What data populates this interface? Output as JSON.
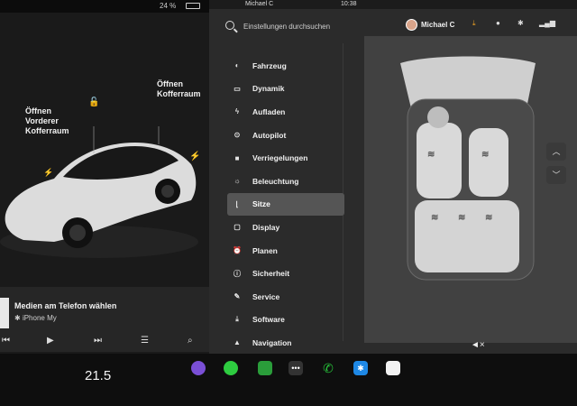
{
  "status_left": {
    "battery": "24 %"
  },
  "car_labels": {
    "front_trunk": [
      "Öffnen",
      "Vorderer",
      "Kofferraum"
    ],
    "rear_trunk": [
      "Öffnen",
      "Kofferraum"
    ]
  },
  "media": {
    "title": "Medien am Telefon wählen",
    "source": "iPhone My",
    "controls": [
      "prev-icon",
      "play-icon",
      "next-icon",
      "equalizer-icon",
      "search-icon"
    ]
  },
  "top_strip": {
    "user": "Michael C",
    "time": "10:38"
  },
  "settings": {
    "search_placeholder": "Einstellungen durchsuchen",
    "profile_name": "Michael C",
    "menu": [
      {
        "label": "Fahrzeug",
        "icon": "toggle-icon"
      },
      {
        "label": "Dynamik",
        "icon": "car-icon"
      },
      {
        "label": "Aufladen",
        "icon": "lightning-icon"
      },
      {
        "label": "Autopilot",
        "icon": "steering-wheel-icon"
      },
      {
        "label": "Verriegelungen",
        "icon": "lock-icon"
      },
      {
        "label": "Beleuchtung",
        "icon": "sun-icon"
      },
      {
        "label": "Sitze",
        "icon": "seat-icon"
      },
      {
        "label": "Display",
        "icon": "display-icon"
      },
      {
        "label": "Planen",
        "icon": "alarm-icon"
      },
      {
        "label": "Sicherheit",
        "icon": "info-icon"
      },
      {
        "label": "Service",
        "icon": "wrench-icon"
      },
      {
        "label": "Software",
        "icon": "download-icon"
      },
      {
        "label": "Navigation",
        "icon": "navigation-icon"
      }
    ],
    "active_item": "Sitze"
  },
  "dock": {
    "temperature": "21.5",
    "apps": [
      "camera-app-icon",
      "green-app-icon",
      "energy-app-icon",
      "more-apps-icon",
      "phone-icon",
      "bluetooth-icon",
      "calendar-icon"
    ],
    "volume": "mute-icon"
  },
  "colors": {
    "accent_green": "#2ecc40",
    "bluetooth_blue": "#1e88e5",
    "phone_green": "#27c13a"
  }
}
